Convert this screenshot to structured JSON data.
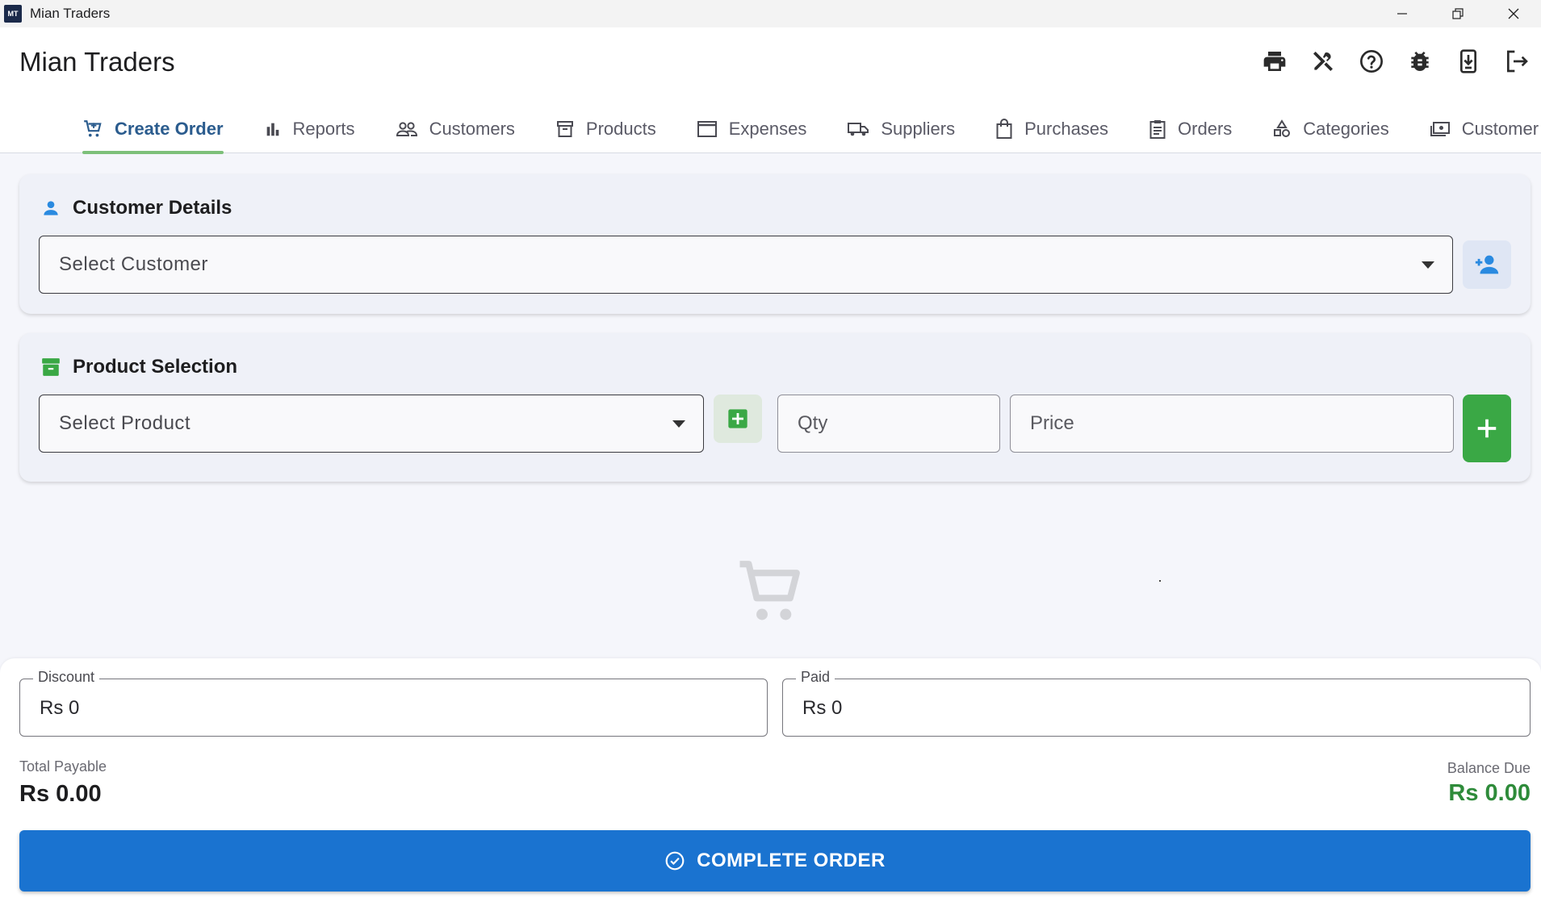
{
  "window": {
    "logo_text": "MT",
    "title": "Mian Traders"
  },
  "appbar": {
    "title": "Mian Traders",
    "toolbar_icons": [
      "print-icon",
      "tools-icon",
      "help-icon",
      "bug-icon",
      "download-icon",
      "logout-icon"
    ]
  },
  "tabs": [
    {
      "label": "Create Order",
      "icon": "cart-icon",
      "active": true
    },
    {
      "label": "Reports",
      "icon": "bar-chart-icon",
      "active": false
    },
    {
      "label": "Customers",
      "icon": "people-icon",
      "active": false
    },
    {
      "label": "Products",
      "icon": "archive-icon",
      "active": false
    },
    {
      "label": "Expenses",
      "icon": "wallet-icon",
      "active": false
    },
    {
      "label": "Suppliers",
      "icon": "truck-icon",
      "active": false
    },
    {
      "label": "Purchases",
      "icon": "bag-icon",
      "active": false
    },
    {
      "label": "Orders",
      "icon": "clipboard-icon",
      "active": false
    },
    {
      "label": "Categories",
      "icon": "category-icon",
      "active": false
    },
    {
      "label": "Customer Pa",
      "icon": "payments-icon",
      "active": false
    }
  ],
  "customer_card": {
    "title": "Customer Details",
    "select_placeholder": "Select Customer"
  },
  "product_card": {
    "title": "Product Selection",
    "select_placeholder": "Select Product",
    "qty_placeholder": "Qty",
    "price_placeholder": "Price"
  },
  "summary": {
    "discount_label": "Discount",
    "discount_value": "Rs 0",
    "paid_label": "Paid",
    "paid_value": "Rs 0",
    "total_label": "Total Payable",
    "total_value": "Rs 0.00",
    "balance_label": "Balance Due",
    "balance_value": "Rs 0.00",
    "complete_label": "COMPLETE ORDER"
  },
  "colors": {
    "primary": "#1a73d0",
    "active_tab": "#2b5c8e",
    "tab_indicator": "#7dc07a",
    "success": "#3aa845",
    "balance_green": "#2e8b3a",
    "person_icon": "#2a8ae0"
  }
}
